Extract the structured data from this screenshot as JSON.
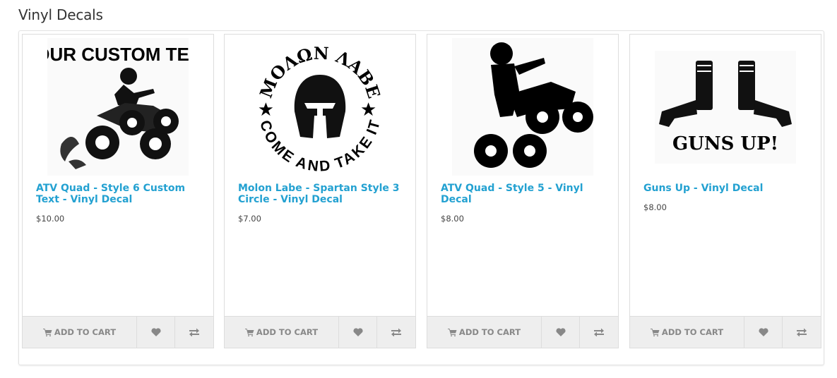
{
  "section": {
    "title": "Vinyl Decals"
  },
  "products": [
    {
      "name": "ATV Quad - Style 6 Custom Text - Vinyl Decal",
      "price": "$10.00",
      "image_text": "YOUR CUSTOM TEXT",
      "image_icon": "atv-rider-icon",
      "add_to_cart": "ADD TO CART"
    },
    {
      "name": "Molon Labe - Spartan Style 3 Circle - Vinyl Decal",
      "price": "$7.00",
      "image_text_top": "ΜΟΛΩΝ ΛΑΒΕ",
      "image_text_bottom": "COME AND TAKE IT",
      "image_icon": "spartan-helmet-icon",
      "add_to_cart": "ADD TO CART"
    },
    {
      "name": "ATV Quad - Style 5 - Vinyl Decal",
      "price": "$8.00",
      "image_icon": "atv-rider-icon",
      "add_to_cart": "ADD TO CART"
    },
    {
      "name": "Guns Up - Vinyl Decal",
      "price": "$8.00",
      "image_text": "GUNS UP!",
      "image_icon": "pistols-icon",
      "add_to_cart": "ADD TO CART"
    }
  ],
  "colors": {
    "link": "#23a1d1",
    "button_bg": "#eeeeee",
    "button_text": "#888888"
  }
}
